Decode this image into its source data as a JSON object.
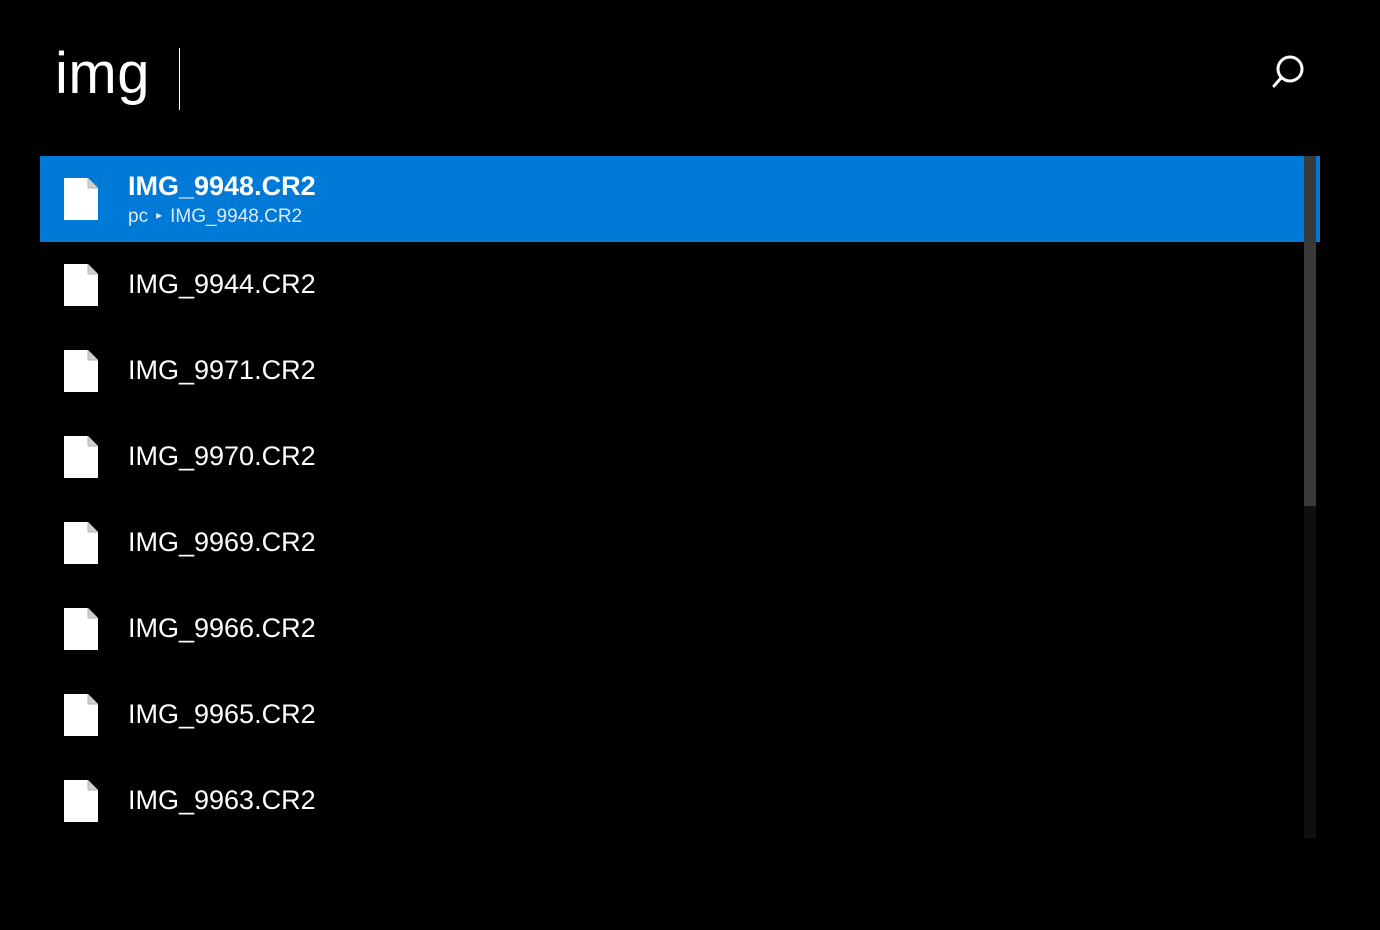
{
  "search": {
    "value": "img"
  },
  "colors": {
    "selection": "#0179d6",
    "background": "#000000",
    "text": "#ffffff"
  },
  "results": [
    {
      "name": "IMG_9948.CR2",
      "selected": true,
      "path": {
        "root": "pc",
        "leaf": "IMG_9948.CR2"
      }
    },
    {
      "name": "IMG_9944.CR2",
      "selected": false
    },
    {
      "name": "IMG_9971.CR2",
      "selected": false
    },
    {
      "name": "IMG_9970.CR2",
      "selected": false
    },
    {
      "name": "IMG_9969.CR2",
      "selected": false
    },
    {
      "name": "IMG_9966.CR2",
      "selected": false
    },
    {
      "name": "IMG_9965.CR2",
      "selected": false
    },
    {
      "name": "IMG_9963.CR2",
      "selected": false
    }
  ]
}
